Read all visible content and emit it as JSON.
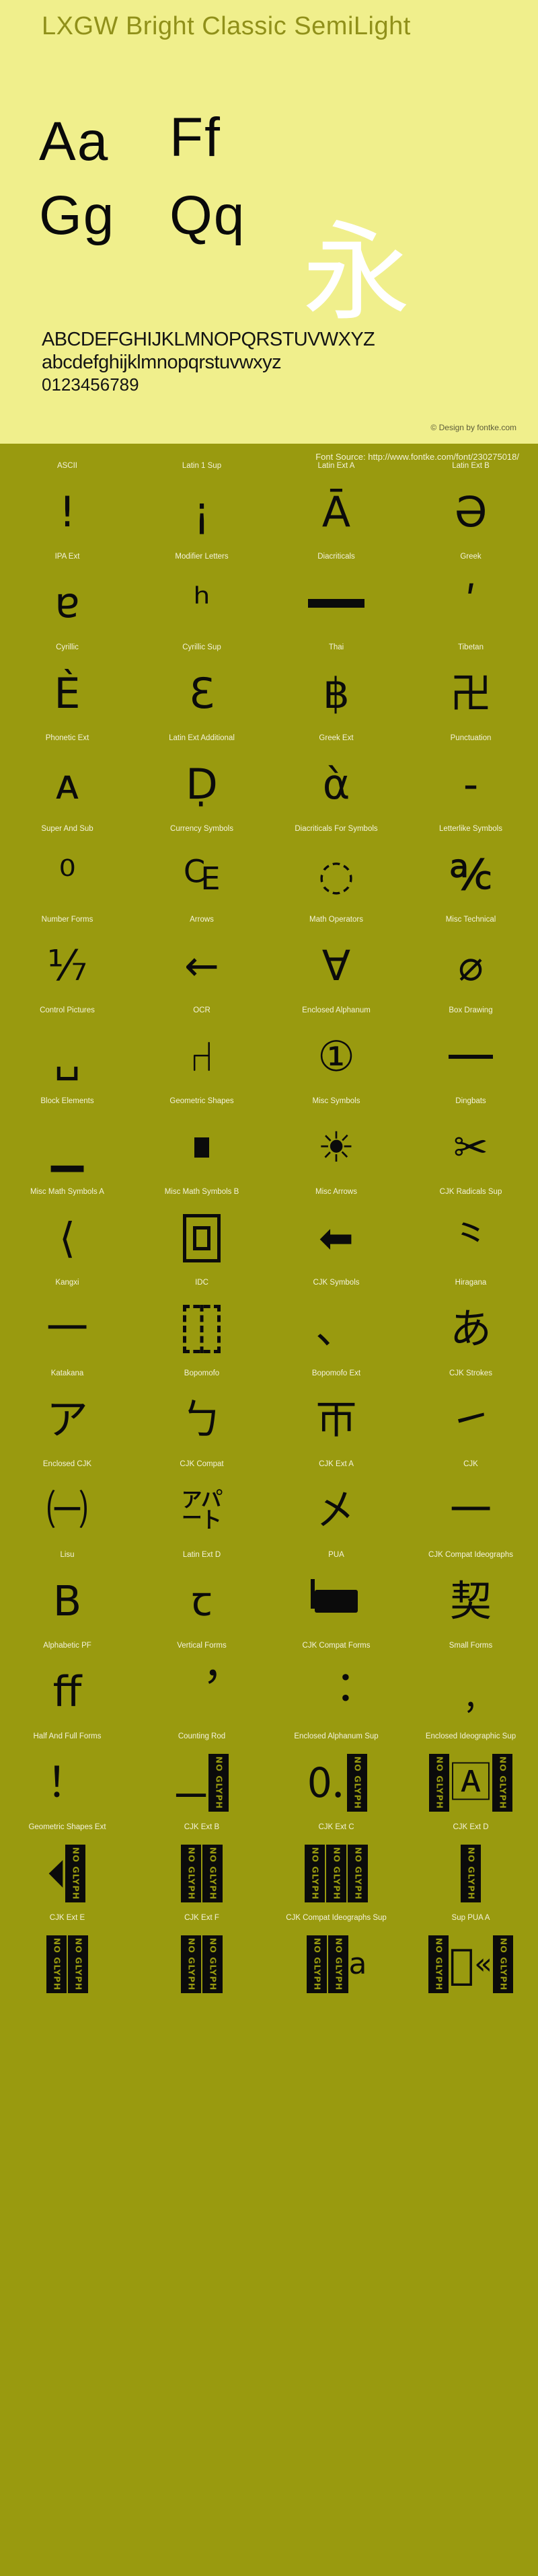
{
  "header": {
    "font_title": "LXGW Bright Classic SemiLight",
    "showcase_pairs": [
      "Aa",
      "Ff",
      "Gg",
      "Qq"
    ],
    "cjk_sample": "永",
    "alphabet_upper": "ABCDEFGHIJKLMNOPQRSTUVWXYZ",
    "alphabet_lower": "abcdefghijklmnopqrstuvwxyz",
    "digits": "0123456789",
    "copyright": "© Design by fontke.com",
    "colors": {
      "header_bg": "#f0ef8c",
      "body_bg": "#999a0f",
      "title_color": "#90901a",
      "glyph_color": "#0b0b0b",
      "cjk_color": "#ffffff",
      "label_color": "#f4f3dc"
    }
  },
  "font_source": {
    "label": "Font Source: http://www.fontke.com/font/230275018/"
  },
  "noglyph_text": "NO GLYPH",
  "blocks": [
    {
      "label": "ASCII",
      "sample": "!",
      "kind": "text"
    },
    {
      "label": "Latin 1 Sup",
      "sample": "¡",
      "kind": "text"
    },
    {
      "label": "Latin Ext A",
      "sample": "Ā",
      "kind": "text"
    },
    {
      "label": "Latin Ext B",
      "sample": "Ə",
      "kind": "text"
    },
    {
      "label": "IPA Ext",
      "sample": "ɐ",
      "kind": "text"
    },
    {
      "label": "Modifier Letters",
      "sample": "ʰ",
      "kind": "text"
    },
    {
      "label": "Diacriticals",
      "sample": "̄",
      "kind": "macron"
    },
    {
      "label": "Greek",
      "sample": "ʹ",
      "kind": "text"
    },
    {
      "label": "Cyrillic",
      "sample": "Ѐ",
      "kind": "text"
    },
    {
      "label": "Cyrillic Sup",
      "sample": "Ԑ",
      "kind": "text"
    },
    {
      "label": "Thai",
      "sample": "฿",
      "kind": "text"
    },
    {
      "label": "Tibetan",
      "sample": "卍",
      "kind": "text"
    },
    {
      "label": "Phonetic Ext",
      "sample": "ᴀ",
      "kind": "text"
    },
    {
      "label": "Latin Ext Additional",
      "sample": "Ḍ",
      "kind": "text"
    },
    {
      "label": "Greek Ext",
      "sample": "ὰ",
      "kind": "text"
    },
    {
      "label": "Punctuation",
      "sample": "‐",
      "kind": "text"
    },
    {
      "label": "Super And Sub",
      "sample": "⁰",
      "kind": "text"
    },
    {
      "label": "Currency Symbols",
      "sample": "₠",
      "kind": "text"
    },
    {
      "label": "Diacriticals For Symbols",
      "sample": "◌",
      "kind": "text"
    },
    {
      "label": "Letterlike Symbols",
      "sample": "℀",
      "kind": "text"
    },
    {
      "label": "Number Forms",
      "sample": "⅐",
      "kind": "text"
    },
    {
      "label": "Arrows",
      "sample": "←",
      "kind": "text"
    },
    {
      "label": "Math Operators",
      "sample": "∀",
      "kind": "text"
    },
    {
      "label": "Misc Technical",
      "sample": "⌀",
      "kind": "text"
    },
    {
      "label": "Control Pictures",
      "sample": "␣",
      "kind": "text"
    },
    {
      "label": "OCR",
      "sample": "⑁",
      "kind": "text"
    },
    {
      "label": "Enclosed Alphanum",
      "sample": "①",
      "kind": "text"
    },
    {
      "label": "Box Drawing",
      "sample": "─",
      "kind": "barthin"
    },
    {
      "label": "Block Elements",
      "sample": "▁",
      "kind": "text"
    },
    {
      "label": "Geometric Shapes",
      "sample": "■",
      "kind": "sqsmall"
    },
    {
      "label": "Misc Symbols",
      "sample": "☀",
      "kind": "text"
    },
    {
      "label": "Dingbats",
      "sample": "✂",
      "kind": "text"
    },
    {
      "label": "Misc Math Symbols A",
      "sample": "⟨",
      "kind": "text"
    },
    {
      "label": "Misc Math Symbols B",
      "sample": "⧉",
      "kind": "shapebox"
    },
    {
      "label": "Misc Arrows",
      "sample": "⬅",
      "kind": "text"
    },
    {
      "label": "CJK Radicals Sup",
      "sample": "⺀",
      "kind": "text"
    },
    {
      "label": "Kangxi",
      "sample": "⼀",
      "kind": "text"
    },
    {
      "label": "IDC",
      "sample": "⿰",
      "kind": "dashedbox"
    },
    {
      "label": "CJK Symbols",
      "sample": "、",
      "kind": "text"
    },
    {
      "label": "Hiragana",
      "sample": "あ",
      "kind": "text"
    },
    {
      "label": "Katakana",
      "sample": "ア",
      "kind": "text"
    },
    {
      "label": "Bopomofo",
      "sample": "ㄅ",
      "kind": "text"
    },
    {
      "label": "Bopomofo Ext",
      "sample": "ㄭ",
      "kind": "text"
    },
    {
      "label": "CJK Strokes",
      "sample": "㇀",
      "kind": "text"
    },
    {
      "label": "Enclosed CJK",
      "sample": "㈠",
      "kind": "text"
    },
    {
      "label": "CJK Compat",
      "sample": "㌀",
      "kind": "text"
    },
    {
      "label": "CJK Ext A",
      "sample": "㐅",
      "kind": "text"
    },
    {
      "label": "CJK",
      "sample": "一",
      "kind": "text"
    },
    {
      "label": "Lisu",
      "sample": "ꓐ",
      "kind": "text"
    },
    {
      "label": "Latin Ext D",
      "sample": "ꞇ",
      "kind": "text"
    },
    {
      "label": "PUA",
      "sample": "",
      "kind": "pua"
    },
    {
      "label": "CJK Compat Ideographs",
      "sample": "契",
      "kind": "text"
    },
    {
      "label": "Alphabetic PF",
      "sample": "ﬀ",
      "kind": "text"
    },
    {
      "label": "Vertical Forms",
      "sample": "︐",
      "kind": "text"
    },
    {
      "label": "CJK Compat Forms",
      "sample": "︓",
      "kind": "text"
    },
    {
      "label": "Small Forms",
      "sample": "﹐",
      "kind": "text"
    },
    {
      "label": "Half And Full Forms",
      "sample": "！",
      "kind": "text"
    },
    {
      "label": "Counting Rod",
      "sample": "𝍠",
      "kind": "mix2"
    },
    {
      "label": "Enclosed Alphanum Sup",
      "sample": "🄀",
      "kind": "mix2"
    },
    {
      "label": "Enclosed Ideographic Sup",
      "sample": "🄰",
      "kind": "mix3"
    },
    {
      "label": "Geometric Shapes Ext",
      "sample": "🞀",
      "kind": "mix2"
    },
    {
      "label": "CJK Ext B",
      "sample": "𠀀",
      "kind": "mix3"
    },
    {
      "label": "CJK Ext C",
      "sample": "𪜀",
      "kind": "mixa"
    },
    {
      "label": "CJK Ext D",
      "sample": "𫝀",
      "kind": "mix2"
    },
    {
      "label": "CJK Ext E",
      "sample": "𫠠",
      "kind": "mix3"
    },
    {
      "label": "CJK Ext F",
      "sample": "𬺰",
      "kind": "mix3"
    },
    {
      "label": "CJK Compat Ideographs Sup",
      "sample": "𪱐",
      "kind": "mixa2"
    },
    {
      "label": "Sup PUA A",
      "sample": "󰀀",
      "kind": "mixchev"
    },
    {
      "label": "",
      "sample": "",
      "kind": "lastrow1"
    },
    {
      "label": "",
      "sample": "",
      "kind": "lastrow2"
    },
    {
      "label": "",
      "sample": "",
      "kind": "lastrow3"
    },
    {
      "label": "",
      "sample": "",
      "kind": "lastrow4"
    }
  ]
}
